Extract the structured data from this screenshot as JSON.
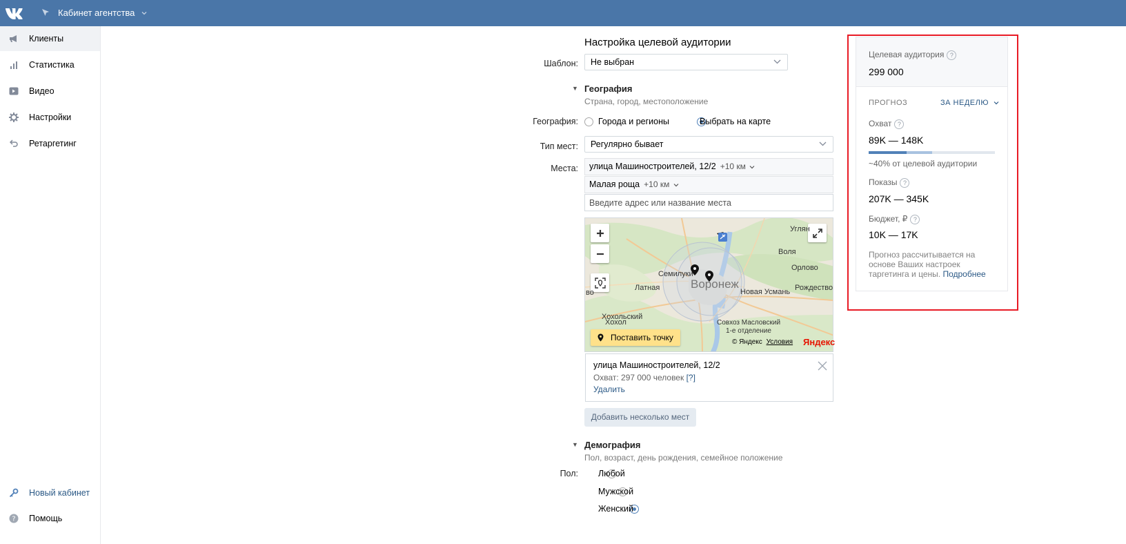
{
  "header": {
    "title": "Кабинет агентства"
  },
  "sidebar": {
    "items": [
      {
        "label": "Клиенты",
        "icon": "megaphone-icon"
      },
      {
        "label": "Статистика",
        "icon": "bar-chart-icon"
      },
      {
        "label": "Видео",
        "icon": "video-icon"
      },
      {
        "label": "Настройки",
        "icon": "gear-icon"
      },
      {
        "label": "Ретаргетинг",
        "icon": "undo-arrow-icon"
      }
    ],
    "bottom": [
      {
        "label": "Новый кабинет",
        "icon": "key-icon"
      },
      {
        "label": "Помощь",
        "icon": "help-icon"
      }
    ]
  },
  "form": {
    "title": "Настройка целевой аудитории",
    "template_label": "Шаблон:",
    "template_value": "Не выбран",
    "geo": {
      "heading": "География",
      "subheading": "Страна, город, местоположение",
      "label": "География:",
      "option_cities": "Города и регионы",
      "option_map": "Выбрать на карте",
      "place_type_label": "Тип мест:",
      "place_type_value": "Регулярно бывает",
      "places_label": "Места:",
      "places": [
        {
          "name": "улица Машиностроителей, 12/2",
          "radius": "+10 км"
        },
        {
          "name": "Малая роща",
          "radius": "+10 км"
        }
      ],
      "address_placeholder": "Введите адрес или название места"
    },
    "map": {
      "labels": {
        "uglyan": "Углян",
        "volya": "Воля",
        "orlovo": "Орлово",
        "semiluki": "Семилуки",
        "voronezh": "Воронеж",
        "latnaya": "Латная",
        "rozhdestveno": "Рождество",
        "novaya_usman": "Новая Усмань",
        "vo": "во",
        "khokholsky": "Хохольский",
        "khokhol": "Хохол",
        "sovkhoz": "Совхоз Масловский",
        "otdelenie": "1-е отделение"
      },
      "put_point": "Поставить точку",
      "copyright": "© Яндекс",
      "terms": "Условия",
      "yandex": "Яндекс"
    },
    "place_card": {
      "name": "улица Машиностроителей, 12/2",
      "reach": "Охват: 297 000 человек",
      "help": "[?]",
      "delete": "Удалить"
    },
    "add_places": "Добавить несколько мест",
    "demo": {
      "heading": "Демография",
      "subheading": "Пол, возраст, день рождения, семейное положение",
      "gender_label": "Пол:",
      "options": [
        "Любой",
        "Мужской",
        "Женский"
      ],
      "selected_index": 2
    }
  },
  "forecast": {
    "audience_label": "Целевая аудитория",
    "audience_value": "299 000",
    "forecast_label": "ПРОГНОЗ",
    "period": "ЗА НЕДЕЛЮ",
    "reach_label": "Охват",
    "reach_value": "89K — 148K",
    "reach_bar": {
      "low_fraction": 0.3,
      "high_fraction": 0.5
    },
    "reach_note": "~40% от целевой аудитории",
    "impressions_label": "Показы",
    "impressions_value": "207K — 345K",
    "budget_label": "Бюджет, ₽",
    "budget_value": "10K — 17K",
    "note_lines": [
      "Прогноз рассчитывается на",
      "основе Ваших настроек",
      "таргетинга и цены."
    ],
    "more_link": "Подробнее",
    "help_mark": "?"
  },
  "colors": {
    "header": "#4a76a8",
    "link": "#2a5885",
    "highlight_frame": "#e81a24",
    "bar_low": "#5181b8",
    "bar_high": "#a8c2e0"
  }
}
